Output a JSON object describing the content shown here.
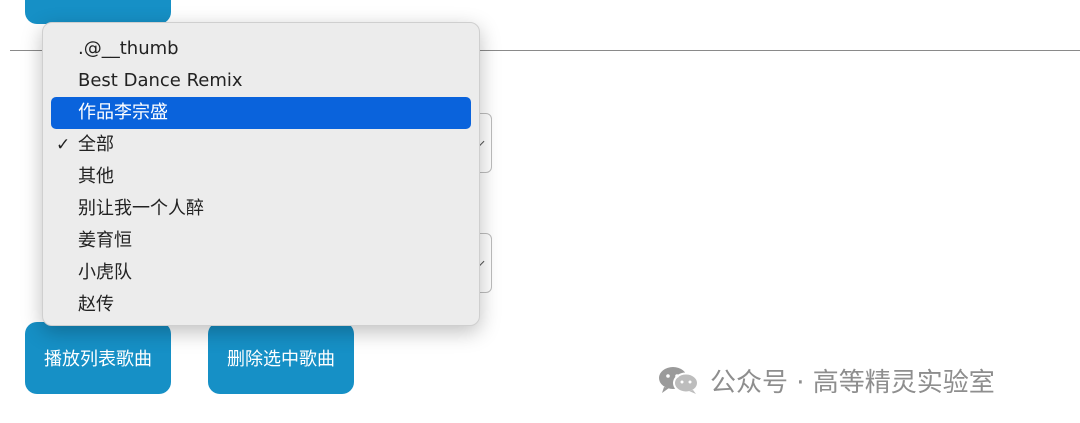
{
  "buttons": {
    "play_label": "播放列表歌曲",
    "delete_label": "删除选中歌曲",
    "top_partial_label": ""
  },
  "dropdown": {
    "options": [
      ".@__thumb",
      "Best Dance Remix",
      "作品李宗盛",
      "全部",
      "其他",
      "别让我一个人醉",
      "姜育恒",
      "小虎队",
      "赵传"
    ],
    "highlighted": "作品李宗盛",
    "checked": "全部",
    "check_mark": "✓"
  },
  "watermark": {
    "text": "公众号 · 高等精灵实验室",
    "icon": "wechat-icon"
  },
  "colors": {
    "button_bg": "#1690c6",
    "highlight_bg": "#0a63dc",
    "menu_bg": "#ececec",
    "watermark_text": "#8e8e8e"
  }
}
